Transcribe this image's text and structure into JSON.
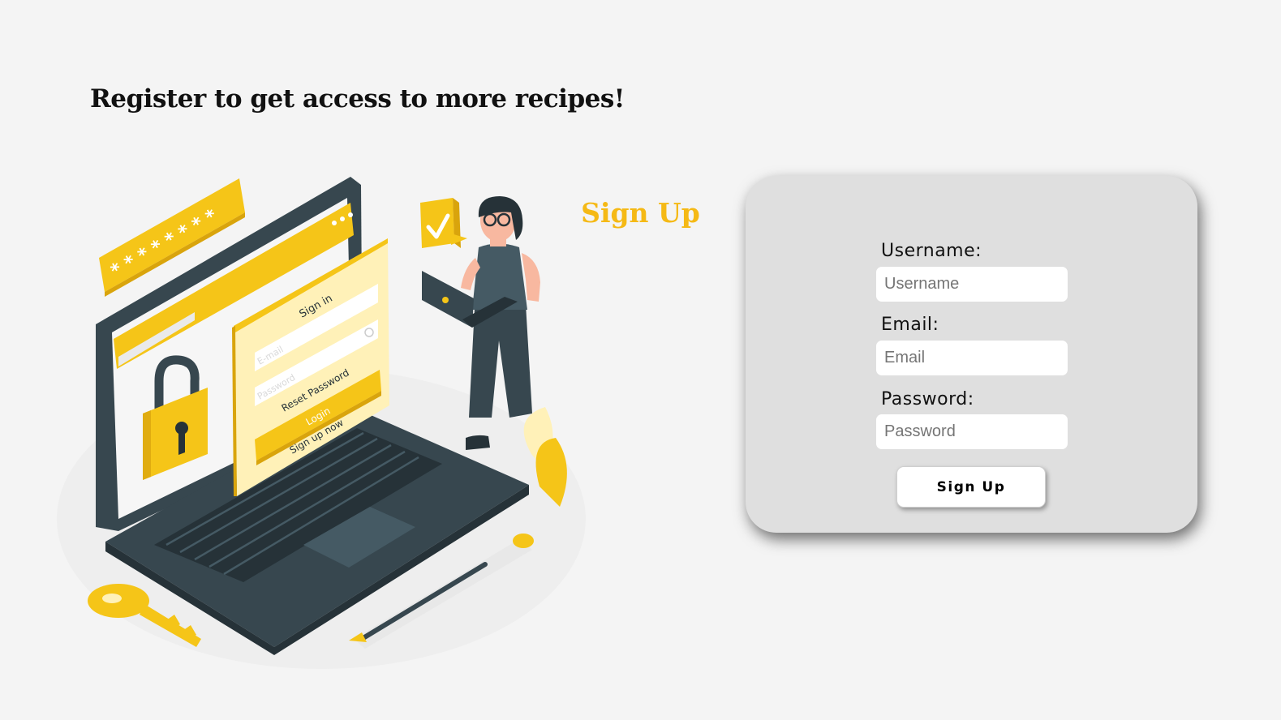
{
  "headline": "Register to get access to more recipes!",
  "illustration": {
    "login_window": {
      "title": "Sign in",
      "email_placeholder": "E-mail",
      "password_placeholder": "Password",
      "reset_link": "Reset Password",
      "login_button": "Login",
      "signup_link": "Sign up now"
    },
    "password_mask": "* * * * * * * *",
    "colors": {
      "accent": "#f5c518",
      "dark": "#37474f"
    }
  },
  "form": {
    "title": "Sign Up",
    "username": {
      "label": "Username:",
      "placeholder": "Username",
      "value": ""
    },
    "email": {
      "label": "Email:",
      "placeholder": "Email",
      "value": ""
    },
    "password": {
      "label": "Password:",
      "placeholder": "Password",
      "value": ""
    },
    "submit_label": "Sign Up",
    "colors": {
      "title": "#f5b915",
      "card_background": "#dfdfdf",
      "page_background": "#f4f4f4"
    }
  }
}
